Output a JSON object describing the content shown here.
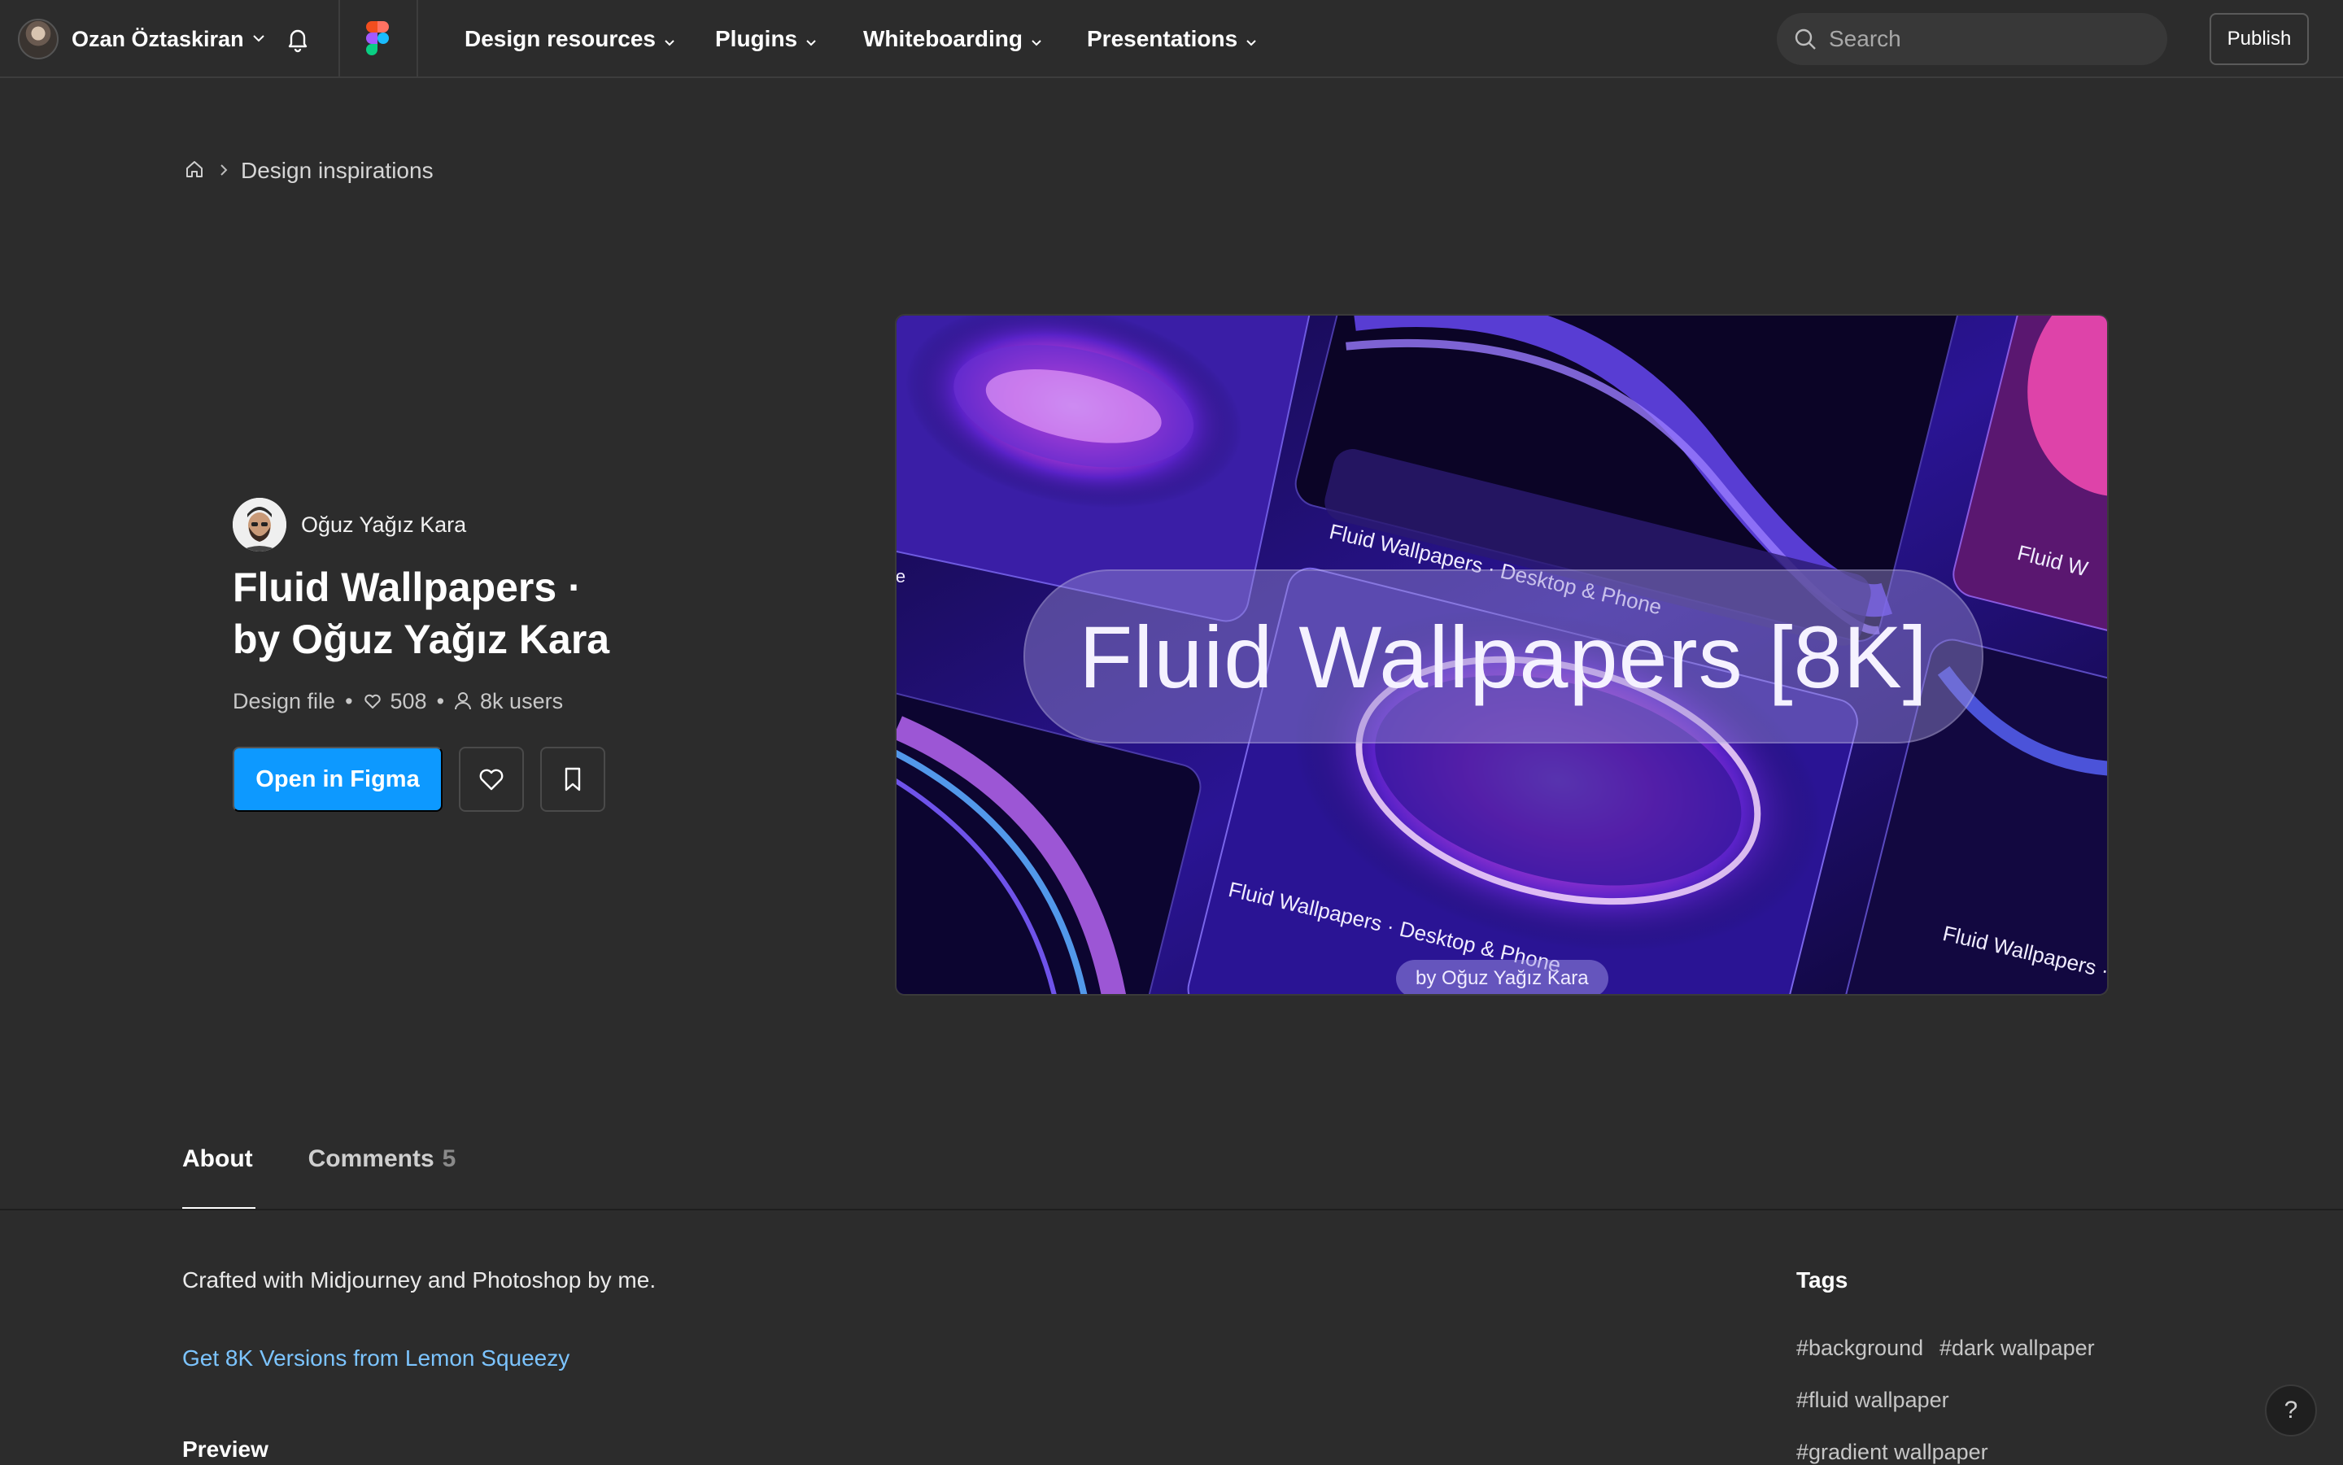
{
  "topbar": {
    "user_name": "Ozan Öztaskiran",
    "nav": [
      "Design resources",
      "Plugins",
      "Whiteboarding",
      "Presentations"
    ],
    "search_placeholder": "Search",
    "publish_label": "Publish",
    "icons": [
      "avatar",
      "chevron-down-icon",
      "bell-icon",
      "figma-logo",
      "search-icon"
    ]
  },
  "breadcrumb": {
    "home_icon": "home-icon",
    "current": "Design inspirations"
  },
  "resource": {
    "author": "Oğuz Yağız Kara",
    "title_line1": "Fluid Wallpapers ·",
    "title_line2": "by Oğuz Yağız Kara",
    "type": "Design file",
    "likes": "508",
    "users": "8k users",
    "open_label": "Open in Figma",
    "like_icon": "heart-icon",
    "bookmark_icon": "bookmark-icon"
  },
  "hero": {
    "headline": "Fluid Wallpapers [8K]",
    "byline": "by Oğuz Yağız Kara",
    "card_caption": "Fluid Wallpapers · Desktop & Phone",
    "card_caption_short": "Fluid W",
    "card_caption_d": "Fluid Wallpapers · D",
    "edge_fragment": "le",
    "colors": {
      "deep": "#1a0d5e",
      "violet": "#3b1aa8",
      "magenta": "#e64ad8",
      "pink": "#ff6fd0"
    }
  },
  "tabs": {
    "about": "About",
    "comments": "Comments",
    "comments_count": "5"
  },
  "about": {
    "description": "Crafted with Midjourney and Photoshop by me.",
    "link": "Get 8K Versions from Lemon Squeezy",
    "preview_heading": "Preview"
  },
  "tags": {
    "heading": "Tags",
    "items": [
      "#background",
      "#dark wallpaper",
      "#fluid wallpaper",
      "#gradient wallpaper"
    ]
  },
  "help": {
    "label": "?"
  },
  "colors": {
    "accent": "#0d99ff",
    "background": "#2c2c2c",
    "link": "#7cc4ff"
  }
}
